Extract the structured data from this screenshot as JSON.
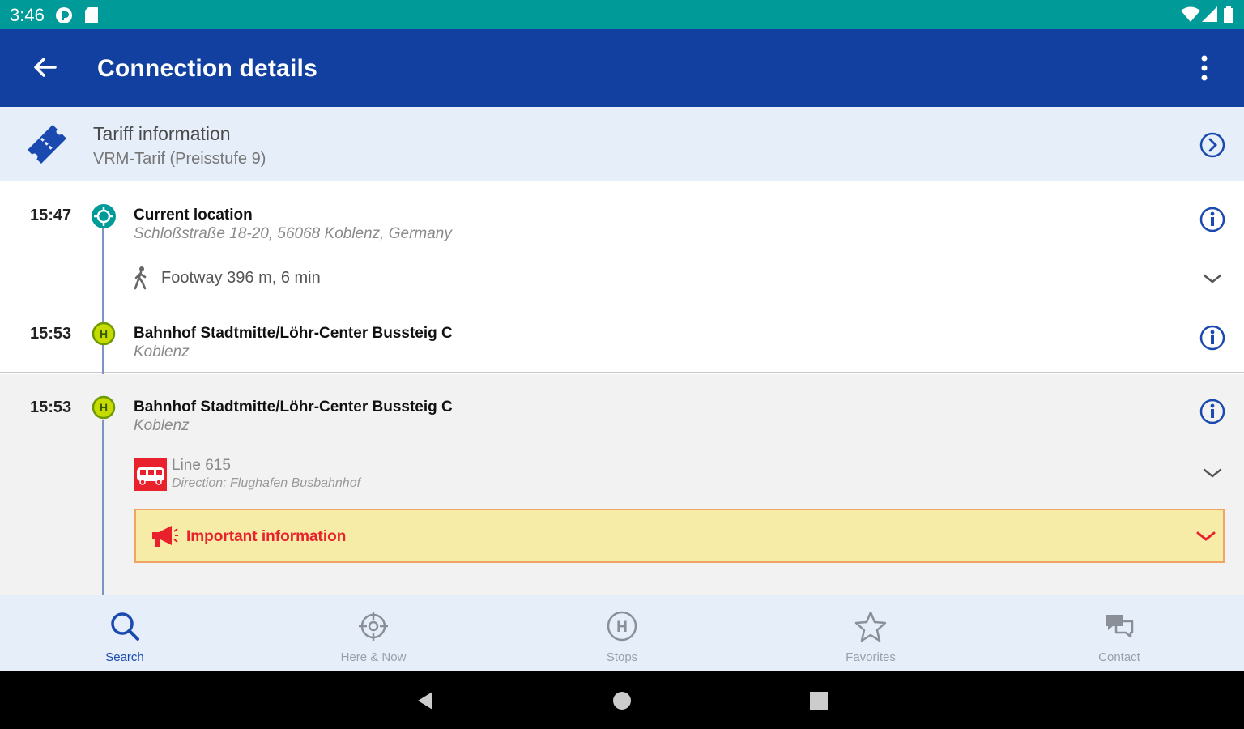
{
  "status_bar": {
    "time": "3:46",
    "left_icons": [
      "pocket-casts-icon",
      "sd-card-icon"
    ],
    "right_icons": [
      "wifi-icon",
      "signal-icon",
      "battery-icon"
    ],
    "color": "#009a98"
  },
  "app_bar": {
    "title": "Connection details",
    "back_icon": "arrow-back-icon",
    "menu_icon": "more-vert-icon",
    "color": "#1140a0"
  },
  "tariff": {
    "title": "Tariff information",
    "subtitle": "VRM-Tarif (Preisstufe 9)",
    "icon": "ticket-icon"
  },
  "legs": [
    {
      "time": "15:47",
      "stop": "Current location",
      "detail": "Schloßstraße 18-20, 56068 Koblenz, Germany",
      "marker": "location-target-icon"
    },
    {
      "walk": "Footway 396 m, 6 min"
    },
    {
      "time": "15:53",
      "stop": "Bahnhof Stadtmitte/Löhr-Center Bussteig C",
      "detail": "Koblenz",
      "marker": "bus-stop-h-icon"
    }
  ],
  "ride": {
    "time": "15:53",
    "stop": "Bahnhof Stadtmitte/Löhr-Center Bussteig C",
    "detail": "Koblenz",
    "line": "Line 615",
    "direction": "Direction: Flughafen Busbahnhof",
    "alert": "Important information"
  },
  "bottom_nav": [
    {
      "label": "Search",
      "icon": "search-icon",
      "active": true
    },
    {
      "label": "Here & Now",
      "icon": "crosshair-icon",
      "active": false
    },
    {
      "label": "Stops",
      "icon": "bus-stop-icon",
      "active": false
    },
    {
      "label": "Favorites",
      "icon": "star-icon",
      "active": false
    },
    {
      "label": "Contact",
      "icon": "chat-icon",
      "active": false
    }
  ],
  "colors": {
    "accent": "#1a49b0",
    "stop_marker": "#c6dc00",
    "alert_bg": "#f6eca7",
    "alert_text": "#e8212c"
  }
}
